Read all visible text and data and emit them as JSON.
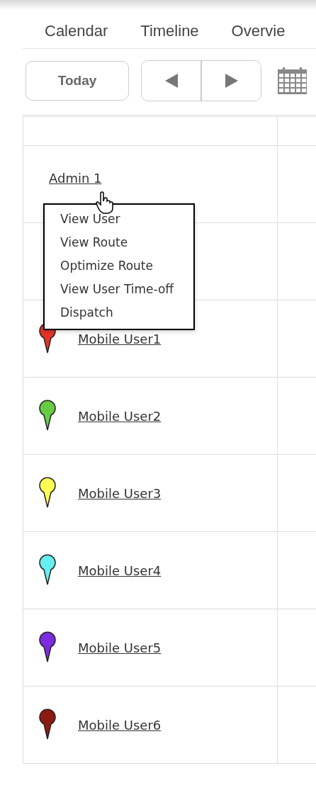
{
  "tabs": [
    {
      "label": "Calendar"
    },
    {
      "label": "Timeline"
    },
    {
      "label": "Overvie"
    }
  ],
  "toolbar": {
    "today": "Today"
  },
  "rows": [
    {
      "kind": "admin",
      "name": "Admin 1"
    },
    {
      "kind": "blank"
    },
    {
      "kind": "mobile",
      "name": "Mobile User1",
      "color": "#e3342a"
    },
    {
      "kind": "mobile",
      "name": "Mobile User2",
      "color": "#66cc44"
    },
    {
      "kind": "mobile",
      "name": "Mobile User3",
      "color": "#ffff55"
    },
    {
      "kind": "mobile",
      "name": "Mobile User4",
      "color": "#66eef0"
    },
    {
      "kind": "mobile",
      "name": "Mobile User5",
      "color": "#7b2be0"
    },
    {
      "kind": "mobile",
      "name": "Mobile User6",
      "color": "#8c1a10"
    }
  ],
  "context_menu": {
    "items": [
      "View User",
      "View Route",
      "Optimize Route",
      "View User Time-off",
      "Dispatch"
    ]
  }
}
